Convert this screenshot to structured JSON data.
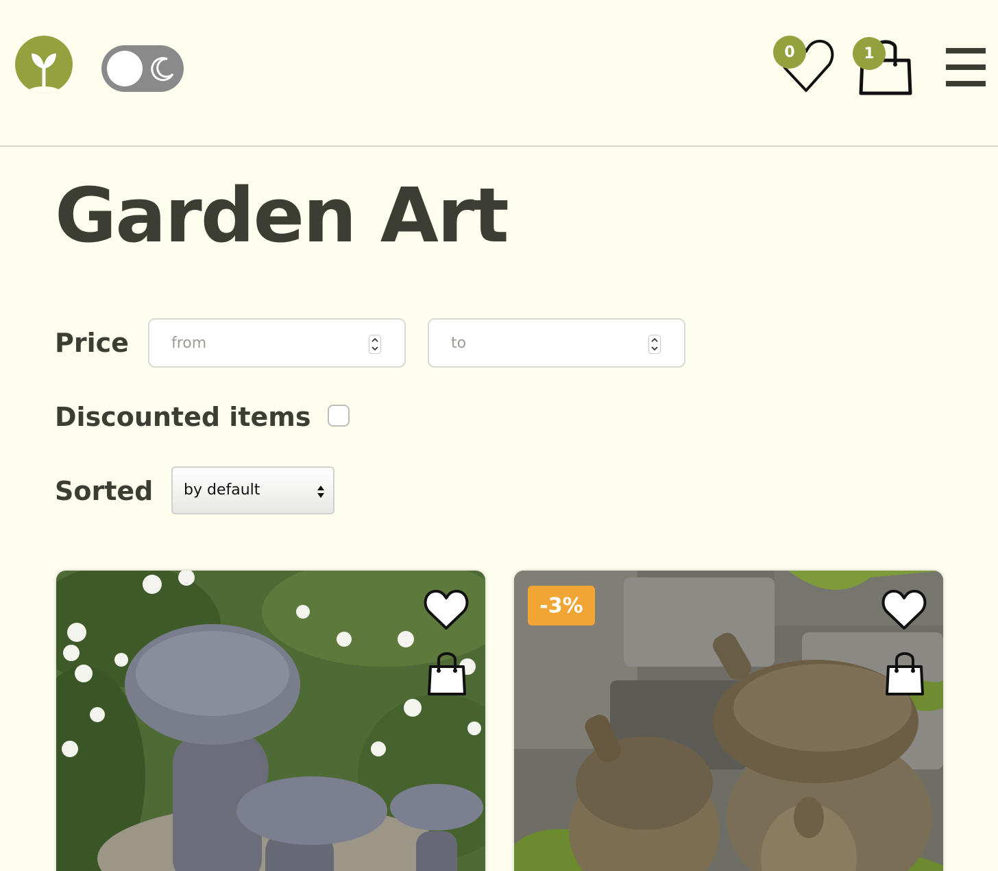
{
  "header": {
    "wishlist_count": "0",
    "cart_count": "1"
  },
  "page": {
    "title": "Garden Art"
  },
  "filters": {
    "price_label": "Price",
    "price_from_placeholder": "from",
    "price_to_placeholder": "to",
    "discount_label": "Discounted items",
    "discount_checked": false,
    "sort_label": "Sorted",
    "sort_value": "by default"
  },
  "products": [
    {
      "image": "stone mushroom sculptures",
      "discount": ""
    },
    {
      "image": "stone acorn sculptures",
      "discount": "-3%"
    }
  ],
  "colors": {
    "background": "#fefeef",
    "accent": "#93a23e",
    "text": "#3c3d33",
    "discount": "#f0a534"
  },
  "icons": [
    "logo-sprout-icon",
    "sun-icon",
    "moon-icon",
    "heart-icon",
    "shopping-bag-icon",
    "menu-icon"
  ]
}
